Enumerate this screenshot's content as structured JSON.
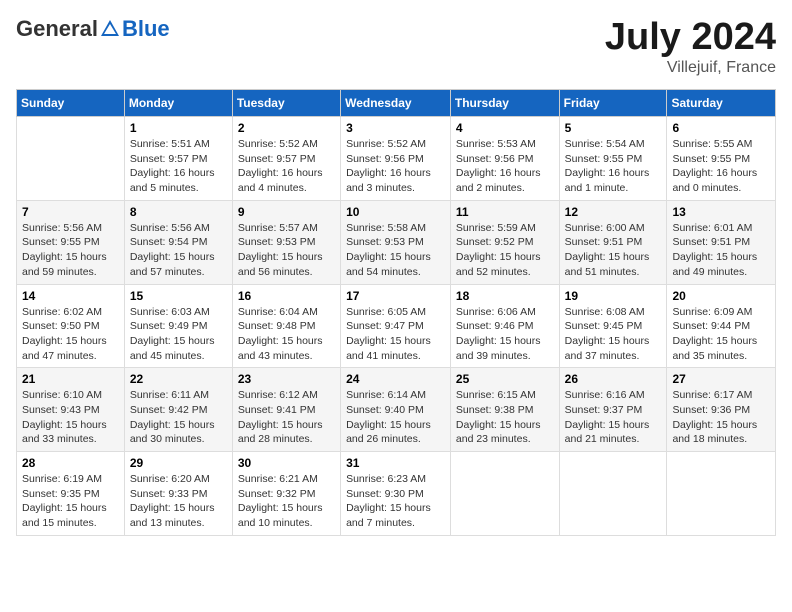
{
  "header": {
    "logo_general": "General",
    "logo_blue": "Blue",
    "month": "July 2024",
    "location": "Villejuif, France"
  },
  "weekdays": [
    "Sunday",
    "Monday",
    "Tuesday",
    "Wednesday",
    "Thursday",
    "Friday",
    "Saturday"
  ],
  "weeks": [
    [
      {
        "day": "",
        "info": ""
      },
      {
        "day": "1",
        "info": "Sunrise: 5:51 AM\nSunset: 9:57 PM\nDaylight: 16 hours\nand 5 minutes."
      },
      {
        "day": "2",
        "info": "Sunrise: 5:52 AM\nSunset: 9:57 PM\nDaylight: 16 hours\nand 4 minutes."
      },
      {
        "day": "3",
        "info": "Sunrise: 5:52 AM\nSunset: 9:56 PM\nDaylight: 16 hours\nand 3 minutes."
      },
      {
        "day": "4",
        "info": "Sunrise: 5:53 AM\nSunset: 9:56 PM\nDaylight: 16 hours\nand 2 minutes."
      },
      {
        "day": "5",
        "info": "Sunrise: 5:54 AM\nSunset: 9:55 PM\nDaylight: 16 hours\nand 1 minute."
      },
      {
        "day": "6",
        "info": "Sunrise: 5:55 AM\nSunset: 9:55 PM\nDaylight: 16 hours\nand 0 minutes."
      }
    ],
    [
      {
        "day": "7",
        "info": "Sunrise: 5:56 AM\nSunset: 9:55 PM\nDaylight: 15 hours\nand 59 minutes."
      },
      {
        "day": "8",
        "info": "Sunrise: 5:56 AM\nSunset: 9:54 PM\nDaylight: 15 hours\nand 57 minutes."
      },
      {
        "day": "9",
        "info": "Sunrise: 5:57 AM\nSunset: 9:53 PM\nDaylight: 15 hours\nand 56 minutes."
      },
      {
        "day": "10",
        "info": "Sunrise: 5:58 AM\nSunset: 9:53 PM\nDaylight: 15 hours\nand 54 minutes."
      },
      {
        "day": "11",
        "info": "Sunrise: 5:59 AM\nSunset: 9:52 PM\nDaylight: 15 hours\nand 52 minutes."
      },
      {
        "day": "12",
        "info": "Sunrise: 6:00 AM\nSunset: 9:51 PM\nDaylight: 15 hours\nand 51 minutes."
      },
      {
        "day": "13",
        "info": "Sunrise: 6:01 AM\nSunset: 9:51 PM\nDaylight: 15 hours\nand 49 minutes."
      }
    ],
    [
      {
        "day": "14",
        "info": "Sunrise: 6:02 AM\nSunset: 9:50 PM\nDaylight: 15 hours\nand 47 minutes."
      },
      {
        "day": "15",
        "info": "Sunrise: 6:03 AM\nSunset: 9:49 PM\nDaylight: 15 hours\nand 45 minutes."
      },
      {
        "day": "16",
        "info": "Sunrise: 6:04 AM\nSunset: 9:48 PM\nDaylight: 15 hours\nand 43 minutes."
      },
      {
        "day": "17",
        "info": "Sunrise: 6:05 AM\nSunset: 9:47 PM\nDaylight: 15 hours\nand 41 minutes."
      },
      {
        "day": "18",
        "info": "Sunrise: 6:06 AM\nSunset: 9:46 PM\nDaylight: 15 hours\nand 39 minutes."
      },
      {
        "day": "19",
        "info": "Sunrise: 6:08 AM\nSunset: 9:45 PM\nDaylight: 15 hours\nand 37 minutes."
      },
      {
        "day": "20",
        "info": "Sunrise: 6:09 AM\nSunset: 9:44 PM\nDaylight: 15 hours\nand 35 minutes."
      }
    ],
    [
      {
        "day": "21",
        "info": "Sunrise: 6:10 AM\nSunset: 9:43 PM\nDaylight: 15 hours\nand 33 minutes."
      },
      {
        "day": "22",
        "info": "Sunrise: 6:11 AM\nSunset: 9:42 PM\nDaylight: 15 hours\nand 30 minutes."
      },
      {
        "day": "23",
        "info": "Sunrise: 6:12 AM\nSunset: 9:41 PM\nDaylight: 15 hours\nand 28 minutes."
      },
      {
        "day": "24",
        "info": "Sunrise: 6:14 AM\nSunset: 9:40 PM\nDaylight: 15 hours\nand 26 minutes."
      },
      {
        "day": "25",
        "info": "Sunrise: 6:15 AM\nSunset: 9:38 PM\nDaylight: 15 hours\nand 23 minutes."
      },
      {
        "day": "26",
        "info": "Sunrise: 6:16 AM\nSunset: 9:37 PM\nDaylight: 15 hours\nand 21 minutes."
      },
      {
        "day": "27",
        "info": "Sunrise: 6:17 AM\nSunset: 9:36 PM\nDaylight: 15 hours\nand 18 minutes."
      }
    ],
    [
      {
        "day": "28",
        "info": "Sunrise: 6:19 AM\nSunset: 9:35 PM\nDaylight: 15 hours\nand 15 minutes."
      },
      {
        "day": "29",
        "info": "Sunrise: 6:20 AM\nSunset: 9:33 PM\nDaylight: 15 hours\nand 13 minutes."
      },
      {
        "day": "30",
        "info": "Sunrise: 6:21 AM\nSunset: 9:32 PM\nDaylight: 15 hours\nand 10 minutes."
      },
      {
        "day": "31",
        "info": "Sunrise: 6:23 AM\nSunset: 9:30 PM\nDaylight: 15 hours\nand 7 minutes."
      },
      {
        "day": "",
        "info": ""
      },
      {
        "day": "",
        "info": ""
      },
      {
        "day": "",
        "info": ""
      }
    ]
  ]
}
